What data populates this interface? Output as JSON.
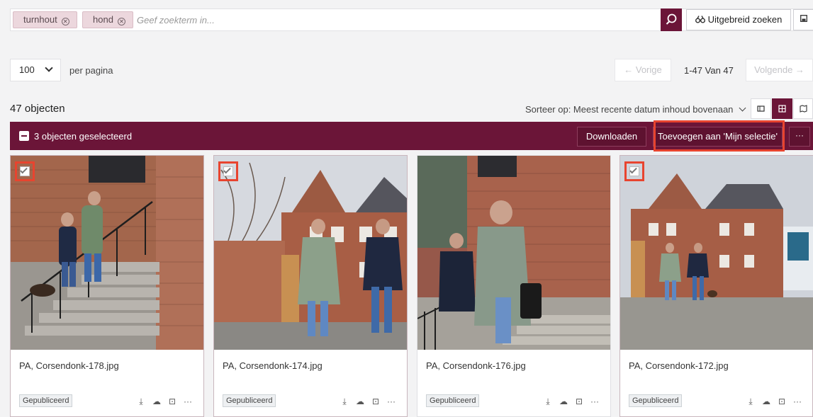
{
  "search": {
    "chips": [
      {
        "label": "turnhout"
      },
      {
        "label": "hond"
      }
    ],
    "placeholder": "Geef zoekterm in...",
    "advanced_label": "Uitgebreid zoeken",
    "search_icon": "search-icon",
    "advanced_icon": "binoculars-icon",
    "save_icon": "save-icon"
  },
  "pagination": {
    "per_page_value": "100",
    "per_page_label": "per pagina",
    "prev_label": "← Vorige",
    "range_label": "1-47 Van 47",
    "next_label": "Volgende →"
  },
  "results": {
    "count_label": "47 objecten",
    "sort_label": "Sorteer op: Meest recente datum inhoud bovenaan",
    "views": [
      "list-view-icon",
      "grid-view-icon",
      "map-view-icon"
    ],
    "active_view": "grid-view-icon"
  },
  "selection": {
    "label": "3 objecten geselecteerd",
    "download_label": "Downloaden",
    "add_label": "Toevoegen aan 'Mijn selectie'",
    "more_label": "···"
  },
  "cards": [
    {
      "filename": "PA, Corsendonk-178.jpg",
      "status": "Gepubliceerd",
      "selected": true
    },
    {
      "filename": "PA, Corsendonk-174.jpg",
      "status": "Gepubliceerd",
      "selected": true
    },
    {
      "filename": "PA, Corsendonk-176.jpg",
      "status": "Gepubliceerd",
      "selected": false
    },
    {
      "filename": "PA, Corsendonk-172.jpg",
      "status": "Gepubliceerd",
      "selected": true
    }
  ],
  "card_actions": [
    "download-icon",
    "cloud-upload-icon",
    "crop-icon",
    "more-icon"
  ],
  "colors": {
    "brand": "#6b1538",
    "highlight": "#e8442f",
    "chip_bg": "#ecd7dd"
  }
}
